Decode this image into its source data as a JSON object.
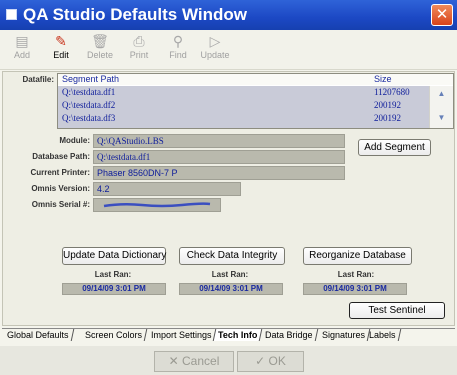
{
  "window": {
    "title": "QA Studio Defaults Window",
    "close_glyph": "✕"
  },
  "toolbar": [
    {
      "label": "Add",
      "icon": "add-icon",
      "glyph": "▤",
      "enabled": false
    },
    {
      "label": "Edit",
      "icon": "edit-icon",
      "glyph": "✎",
      "enabled": true
    },
    {
      "label": "Delete",
      "icon": "delete-icon",
      "glyph": "🗑",
      "enabled": false
    },
    {
      "label": "Print",
      "icon": "print-icon",
      "glyph": "⎙",
      "enabled": false
    },
    {
      "label": "Find",
      "icon": "find-icon",
      "glyph": "⚲",
      "enabled": false
    },
    {
      "label": "Update",
      "icon": "update-icon",
      "glyph": "▷",
      "enabled": false
    }
  ],
  "datafile": {
    "label": "Datafile:",
    "columns": {
      "path": "Segment Path",
      "size": "Size"
    },
    "rows": [
      {
        "path": "Q:\\testdata.df1",
        "size": "11207680"
      },
      {
        "path": "Q:\\testdata.df2",
        "size": "200192"
      },
      {
        "path": "Q:\\testdata.df3",
        "size": "200192"
      }
    ]
  },
  "fields": {
    "module": {
      "label": "Module:",
      "value": "Q:\\QAStudio.LBS"
    },
    "database_path": {
      "label": "Database Path:",
      "value": "Q:\\testdata.df1"
    },
    "current_printer": {
      "label": "Current Printer:",
      "value": "Phaser 8560DN-7 P"
    },
    "omnis_version": {
      "label": "Omnis Version:",
      "value": "4.2"
    },
    "omnis_serial": {
      "label": "Omnis Serial #:",
      "value": ""
    }
  },
  "buttons": {
    "add_segment": "Add Segment",
    "update_dictionary": "Update Data Dictionary",
    "check_integrity": "Check Data Integrity",
    "reorganize": "Reorganize Database",
    "test_sentinel": "Test Sentinel",
    "cancel": "Cancel",
    "ok": "OK"
  },
  "last_ran": {
    "label": "Last Ran:",
    "update_dictionary": "09/14/09 3:01 PM",
    "check_integrity": "09/14/09 3:01 PM",
    "reorganize": "09/14/09 3:01 PM"
  },
  "tabs": [
    "Global Defaults",
    "Screen Colors",
    "Import Settings",
    "Tech Info",
    "Data Bridge",
    "Signatures",
    "Labels"
  ],
  "active_tab": "Tech Info",
  "colors": {
    "titlebar": "#1c48c4",
    "accent_text": "#1a2aa0",
    "close_button": "#d8431b"
  }
}
